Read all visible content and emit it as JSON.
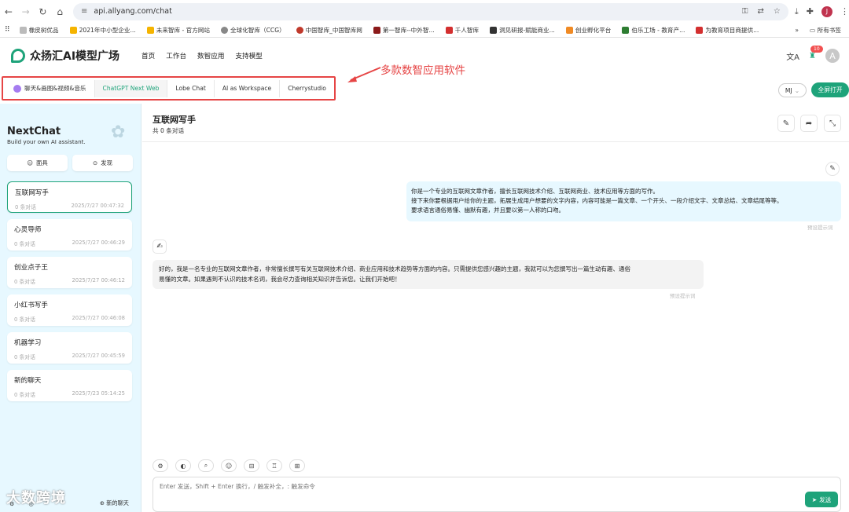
{
  "browser": {
    "url": "api.allyang.com/chat",
    "bookmarks": [
      "橡皮树优品",
      "2021年中小型企业...",
      "未来智库 - 官方网站",
      "全球化智库（CCG）",
      "中国智库_中国智库网",
      "第一智库--中外智...",
      "千人智库",
      "洞见研报-赋能商业...",
      "创业孵化平台",
      "伯乐工场 - 教育产...",
      "为教育项目商提供..."
    ],
    "bookmarks_overflow": "»",
    "all_bookmarks": "所有书签"
  },
  "app": {
    "logo_text": "众扬汇AI模型广场",
    "nav": [
      "首页",
      "工作台",
      "数智应用",
      "支持模型"
    ],
    "notif_count": "10",
    "avatar_letter": "A"
  },
  "tabs": {
    "first": "聊天&画图&视频&音乐",
    "items": [
      "ChatGPT Next Web",
      "Lobe Chat",
      "AI as Workspace",
      "Cherrystudio"
    ],
    "mj_label": "MJ",
    "fullscreen_label": "全屏打开"
  },
  "annotation": "多款数智应用软件",
  "sidebar": {
    "title": "NextChat",
    "subtitle": "Build your own AI assistant.",
    "btn_mask": "面具",
    "btn_discover": "发现",
    "chats": [
      {
        "title": "互联网写手",
        "count": "0 条对话",
        "time": "2025/7/27 00:47:32"
      },
      {
        "title": "心灵导师",
        "count": "0 条对话",
        "time": "2025/7/27 00:46:29"
      },
      {
        "title": "创业点子王",
        "count": "0 条对话",
        "time": "2025/7/27 00:46:12"
      },
      {
        "title": "小红书写手",
        "count": "0 条对话",
        "time": "2025/7/27 00:46:08"
      },
      {
        "title": "机器学习",
        "count": "0 条对话",
        "time": "2025/7/27 00:45:59"
      },
      {
        "title": "新的聊天",
        "count": "0 条对话",
        "time": "2025/7/23 05:14:25"
      }
    ],
    "new_chat": "新的聊天"
  },
  "chat": {
    "title": "互联网写手",
    "count": "共 0 条对话",
    "user_message_lines": [
      "你是一个专业的互联网文章作者，擅长互联网技术介绍、互联网商业、技术应用等方面的写作。",
      "接下来你要根据用户给你的主题，拓展生成用户想要的文字内容，内容可能是一篇文章、一个开头、一段介绍文字、文章总结、文章结尾等等。",
      "要求语言通俗易懂、幽默有趣，并且要以第一人称的口吻。"
    ],
    "user_hint": "预设提示词",
    "bot_message_lines": [
      "好的，我是一名专业的互联网文章作者，非常擅长撰写有关互联网技术介绍、商业应用和技术趋势等方面的内容。只需提供您感兴趣的主题，我就可以为您撰写出一篇生动有趣、通俗",
      "易懂的文章。如果遇到不认识的技术名词，我会尽力查询相关知识并告诉您。让我们开始吧！"
    ],
    "bot_hint": "预设提示词",
    "input_placeholder": "Enter 发送，Shift + Enter 换行，/ 触发补全，: 触发命令",
    "send_label": "发送"
  },
  "watermark": "大数跨境"
}
